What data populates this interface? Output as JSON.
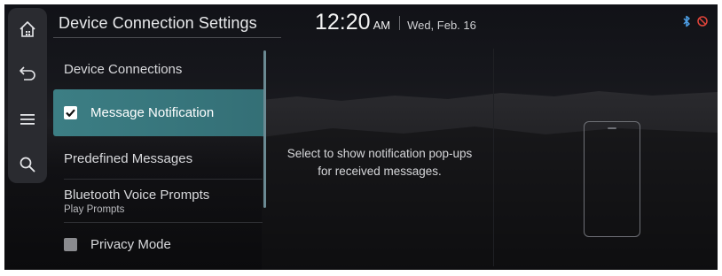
{
  "header": {
    "title": "Device Connection Settings",
    "time": "12:20",
    "ampm": "AM",
    "date": "Wed, Feb. 16"
  },
  "rail": {
    "items": [
      {
        "icon": "home-icon"
      },
      {
        "icon": "back-icon"
      },
      {
        "icon": "menu-icon"
      },
      {
        "icon": "search-icon"
      }
    ]
  },
  "status_icons": [
    "bluetooth-icon",
    "no-signal-icon"
  ],
  "menu": {
    "items": [
      {
        "label": "Device Connections"
      },
      {
        "label": "Message Notification",
        "checked": true,
        "selected": true
      },
      {
        "label": "Predefined Messages"
      },
      {
        "label": "Bluetooth Voice Prompts",
        "sublabel": "Play Prompts"
      },
      {
        "label": "Privacy Mode",
        "checked": false
      }
    ]
  },
  "description": {
    "line1": "Select to show notification pop-ups",
    "line2": "for received messages."
  },
  "colors": {
    "accent": "#3c7e84",
    "background": "#111217",
    "text": "#d8d9dc"
  }
}
